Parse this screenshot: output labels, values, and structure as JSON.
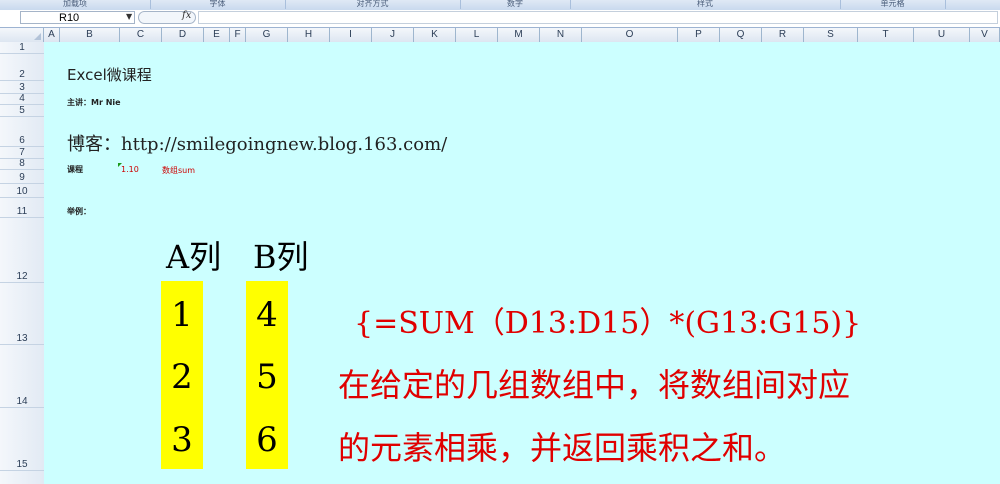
{
  "ribbon": {
    "groups": [
      "加载项",
      "字体",
      "对齐方式",
      "数字",
      "样式",
      "单元格"
    ]
  },
  "formula_bar": {
    "name_box": "R10",
    "fx_label": "fx",
    "formula": ""
  },
  "columns": [
    "A",
    "B",
    "C",
    "D",
    "E",
    "F",
    "G",
    "H",
    "I",
    "J",
    "K",
    "L",
    "M",
    "N",
    "O",
    "P",
    "Q",
    "R",
    "S",
    "T",
    "U",
    "V"
  ],
  "rows": [
    "1",
    "2",
    "3",
    "4",
    "5",
    "6",
    "7",
    "8",
    "9",
    "10",
    "11",
    "12",
    "13",
    "14",
    "15"
  ],
  "sheet": {
    "title": "Excel微课程",
    "presenter": "主讲：Mr Nie",
    "blog": "博客：http://smilegoingnew.blog.163.com/",
    "course_label": "课程",
    "course_number": "1.10",
    "course_topic": "数组sum",
    "example_label": "举例：",
    "col_a_header": "A列",
    "col_b_header": "B列",
    "col_a_values": [
      "1",
      "2",
      "3"
    ],
    "col_b_values": [
      "4",
      "5",
      "6"
    ],
    "formula": "{=SUM（D13:D15）*(G13:G15)}",
    "explanation_line1": "在给定的几组数组中，将数组间对应",
    "explanation_line2": "的元素相乘，并返回乘积之和。"
  },
  "colors": {
    "sheet_bg": "#ccffff",
    "highlight": "#ffff00",
    "accent_red": "#e00000"
  }
}
